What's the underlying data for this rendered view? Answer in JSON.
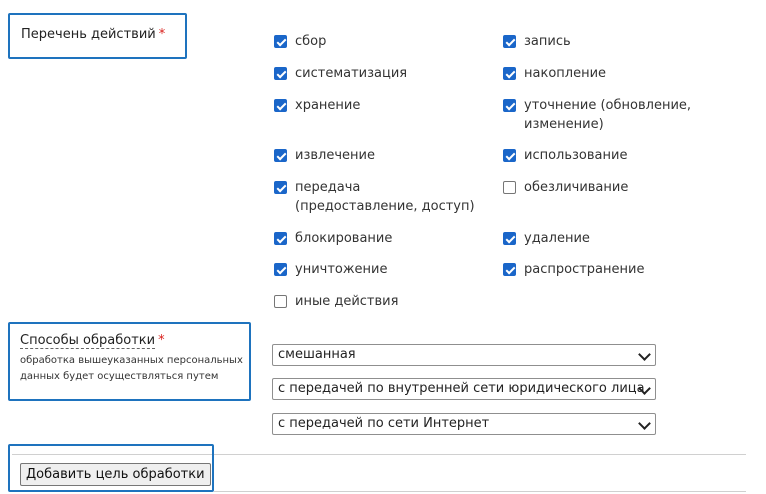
{
  "actions": {
    "label": "Перечень действий",
    "required_mark": "*",
    "items": [
      {
        "label": "сбор",
        "checked": true
      },
      {
        "label": "запись",
        "checked": true
      },
      {
        "label": "систематизация",
        "checked": true
      },
      {
        "label": "накопление",
        "checked": true
      },
      {
        "label": "хранение",
        "checked": true
      },
      {
        "label": "уточнение (обновление, изменение)",
        "checked": true
      },
      {
        "label": "извлечение",
        "checked": true
      },
      {
        "label": "использование",
        "checked": true
      },
      {
        "label": "передача (предоставление, доступ)",
        "checked": true
      },
      {
        "label": "обезличивание",
        "checked": false
      },
      {
        "label": "блокирование",
        "checked": true
      },
      {
        "label": "удаление",
        "checked": true
      },
      {
        "label": "уничтожение",
        "checked": true
      },
      {
        "label": "распространение",
        "checked": true
      },
      {
        "label": "иные действия",
        "checked": false
      }
    ]
  },
  "methods": {
    "label": "Способы обработки",
    "required_mark": "*",
    "hint": "обработка вышеуказанных персональных данных будет осуществляться путем",
    "selects": [
      {
        "value": "смешанная"
      },
      {
        "value": "с передачей по внутренней сети юридического лица"
      },
      {
        "value": "с передачей по сети Интернет"
      }
    ]
  },
  "add_button_label": "Добавить цель обработки",
  "colors": {
    "highlight": "#1e73be",
    "checkbox": "#1a66c9",
    "required": "#d9201c"
  }
}
